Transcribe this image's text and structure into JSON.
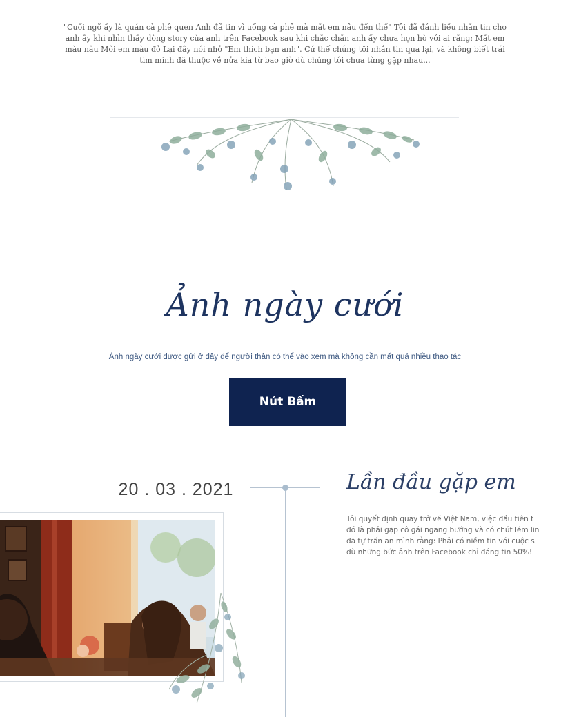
{
  "intro": {
    "lines": [
      "\"Cuối ngõ ấy là quán cà phê quen Anh đã tin vì uống cà phê mà mắt em nâu đến thế\" Tôi đã đánh liều nhắn tin cho",
      "anh ấy khi nhìn thấy dòng story của anh trên Facebook sau khi chắc chắn anh ấy chưa hẹn hò với ai rằng: Mắt em",
      "màu nâu Môi em màu đỏ Lại đây nói nhỏ \"Em thích bạn anh\". Cứ thế chúng tôi nhắn tin qua lại, và không biết trái",
      "tim mình đã thuộc về nửa kia từ bao giờ dù chúng tôi chưa từng gặp nhau..."
    ]
  },
  "gallery": {
    "title": "Ảnh ngày cưới",
    "subtitle": "Ảnh ngày cưới được gửi ở đây để người thân có thể vào xem mà không cần mất quá nhiều thao tác",
    "button_label": "Nút Bấm"
  },
  "timeline": {
    "event": {
      "date": "20 . 03 . 2021",
      "title": "Lần đầu gặp em",
      "lines": [
        "Tôi quyết định quay trở về Việt Nam, việc đầu tiên t",
        "đó là phải gặp cô gái ngang bướng và có chút lém lin",
        "đã tự trấn an mình rằng: Phải có niềm tin với cuộc s",
        "dù những bức ảnh trên Facebook chỉ đáng tin 50%!"
      ]
    }
  },
  "colors": {
    "navy": "#0f2350",
    "title_blue": "#1e3460",
    "leaf_green": "#8fae9c",
    "leaf_blue": "#7f9fb5"
  },
  "icons": {
    "top_ornament": "eucalyptus-garland-icon",
    "photo_ornament": "eucalyptus-sprig-icon"
  }
}
